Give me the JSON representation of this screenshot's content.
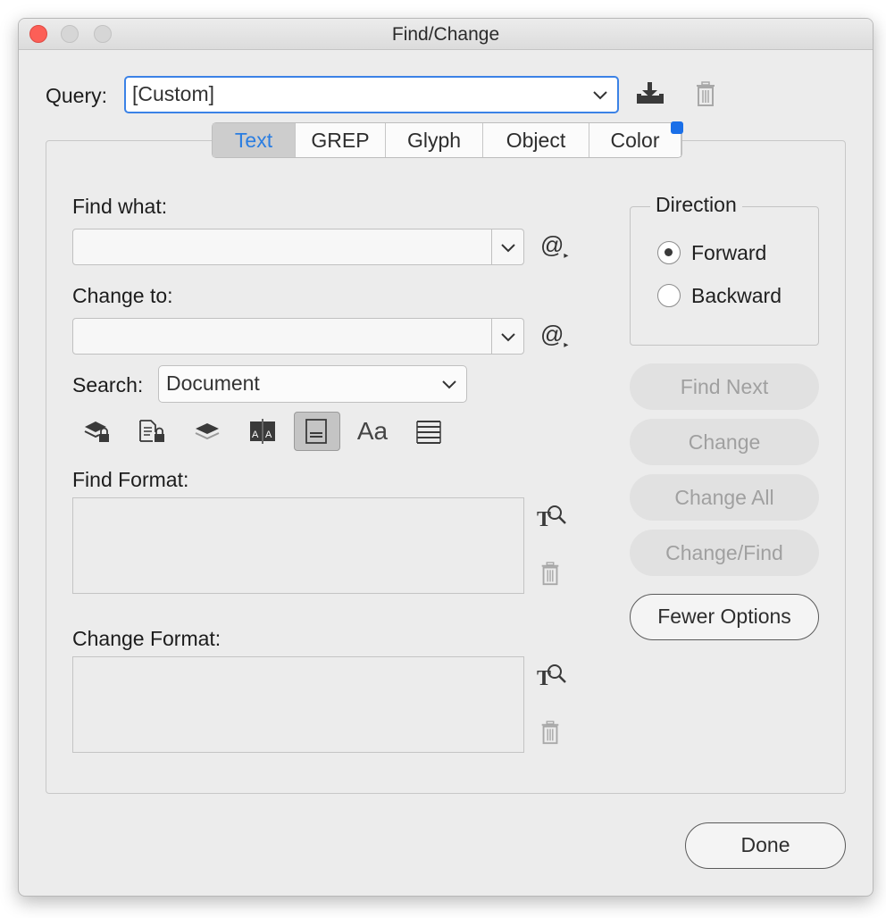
{
  "window": {
    "title": "Find/Change"
  },
  "query": {
    "label": "Query:",
    "value": "[Custom]",
    "icons": [
      "save-query-icon",
      "delete-query-icon"
    ]
  },
  "tabs": [
    {
      "label": "Text",
      "active": true
    },
    {
      "label": "GREP",
      "active": false
    },
    {
      "label": "Glyph",
      "active": false
    },
    {
      "label": "Object",
      "active": false
    },
    {
      "label": "Color",
      "active": false
    }
  ],
  "find_what": {
    "label": "Find what:",
    "value": ""
  },
  "change_to": {
    "label": "Change to:",
    "value": ""
  },
  "special_char_symbol": "@",
  "search": {
    "label": "Search:",
    "value": "Document"
  },
  "search_options": [
    {
      "icon": "include-locked-layers-icon",
      "active": false
    },
    {
      "icon": "include-locked-stories-icon",
      "active": false
    },
    {
      "icon": "include-hidden-layers-icon",
      "active": false
    },
    {
      "icon": "include-master-pages-icon",
      "active": false
    },
    {
      "icon": "include-footnotes-icon",
      "active": true
    },
    {
      "icon": "case-sensitive-icon",
      "text": "Aa",
      "active": false
    },
    {
      "icon": "whole-word-icon",
      "active": false
    }
  ],
  "find_format": {
    "label": "Find Format:"
  },
  "change_format": {
    "label": "Change Format:"
  },
  "direction": {
    "legend": "Direction",
    "options": [
      {
        "label": "Forward",
        "selected": true
      },
      {
        "label": "Backward",
        "selected": false
      }
    ]
  },
  "buttons": {
    "find_next": "Find Next",
    "change": "Change",
    "change_all": "Change All",
    "change_find": "Change/Find",
    "fewer_options": "Fewer Options",
    "done": "Done"
  },
  "colors": {
    "accent": "#2a7de1",
    "focus_ring": "#3b82e6",
    "close": "#fc5f57",
    "tab_dot": "#1a6fe8"
  }
}
